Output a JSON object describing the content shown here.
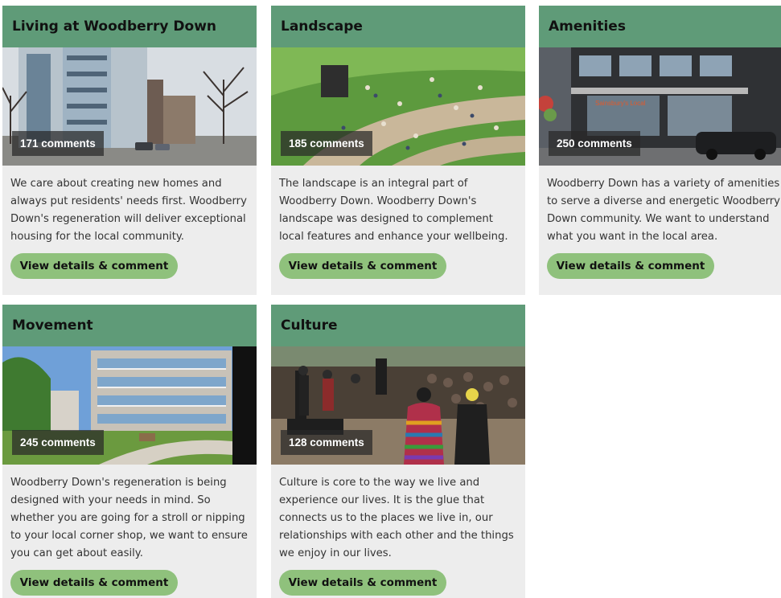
{
  "cards": [
    {
      "title": "Living at Woodberry Down",
      "comments": "171 comments",
      "description": "We care about creating new homes and always put residents' needs first. Woodberry Down's regeneration will deliver exceptional housing for the local community.",
      "button": "View details & comment"
    },
    {
      "title": "Landscape",
      "comments": "185 comments",
      "description": "The landscape is an integral part of Woodberry Down. Woodberry Down's landscape was designed to complement local features and enhance your wellbeing.",
      "button": "View details & comment"
    },
    {
      "title": "Amenities",
      "comments": "250 comments",
      "description": "Woodberry Down has a variety of amenities to serve a diverse and energetic Woodberry Down community. We want to understand what you want in the local area.",
      "button": "View details & comment"
    },
    {
      "title": "Movement",
      "comments": "245 comments",
      "description": "Woodberry Down's regeneration is being designed with your needs in mind. So whether you are going for a stroll or nipping to your local corner shop, we want to ensure you can get about easily.",
      "button": "View details & comment"
    },
    {
      "title": "Culture",
      "comments": "128 comments",
      "description": "Culture is core to the way we live and experience our lives. It is the glue that connects us to the places we live in, our relationships with each other and the things we enjoy in our lives.",
      "button": "View details & comment"
    }
  ],
  "colors": {
    "header": "#5f9b78",
    "button": "#8fc17c",
    "card_bg": "#ededed"
  }
}
